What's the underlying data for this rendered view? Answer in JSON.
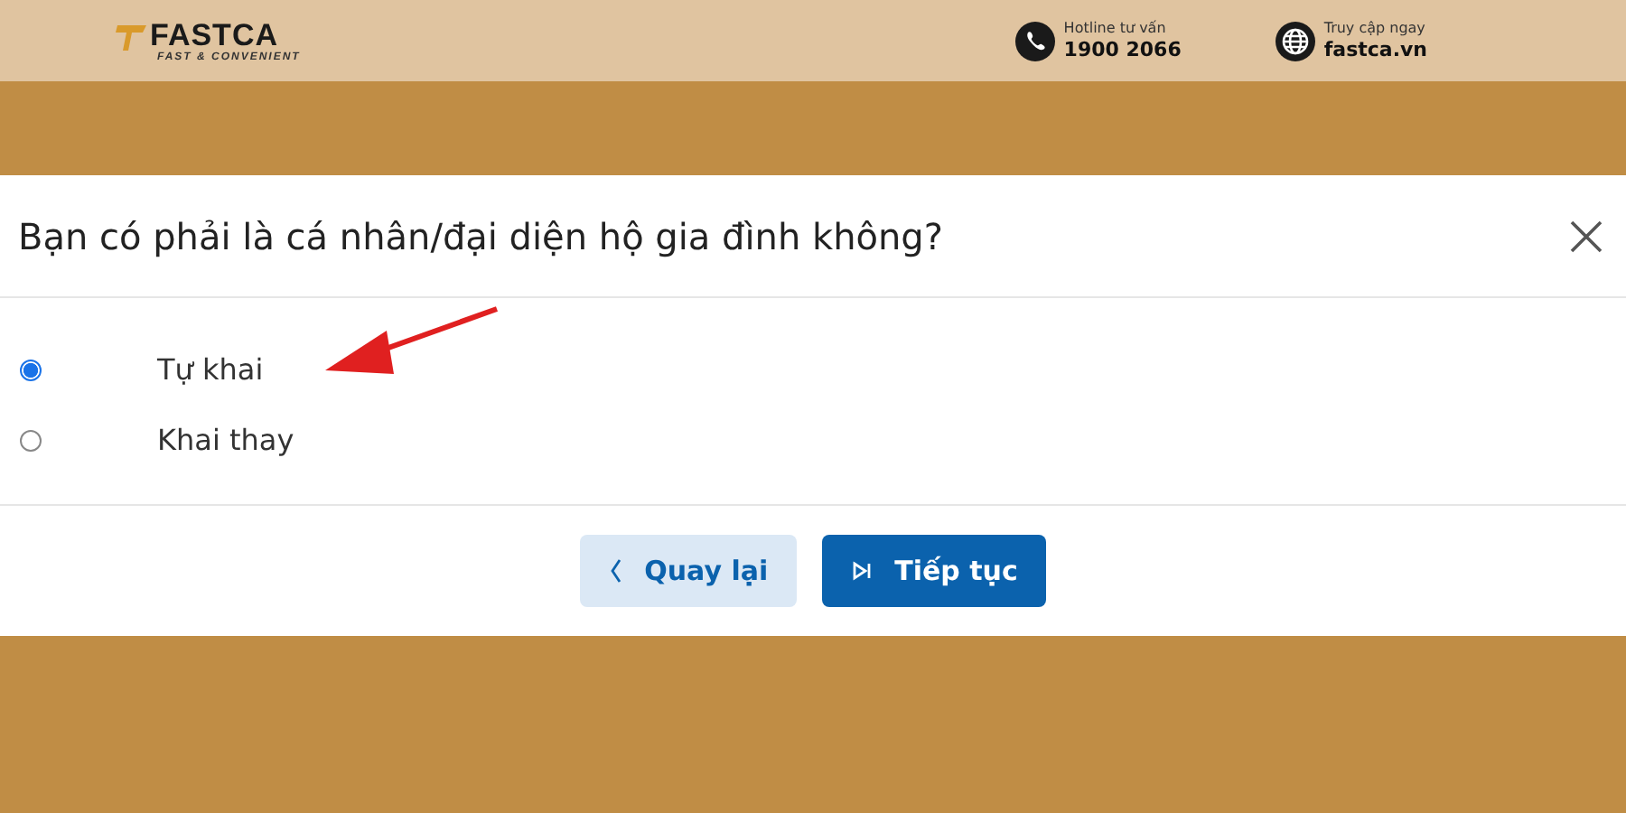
{
  "header": {
    "logo": {
      "name": "FASTCA",
      "tagline": "FAST & CONVENIENT"
    },
    "contacts": [
      {
        "kind": "phone",
        "label": "Hotline tư vấn",
        "value": "1900 2066"
      },
      {
        "kind": "globe",
        "label": "Truy cập ngay",
        "value": "fastca.vn"
      }
    ]
  },
  "dialog": {
    "title": "Bạn có phải là cá nhân/đại diện hộ gia đình không?",
    "options": [
      {
        "label": "Tự khai",
        "selected": true
      },
      {
        "label": "Khai thay",
        "selected": false
      }
    ],
    "buttons": [
      {
        "kind": "back",
        "label": "Quay lại"
      },
      {
        "kind": "next",
        "label": "Tiếp tục"
      }
    ]
  }
}
